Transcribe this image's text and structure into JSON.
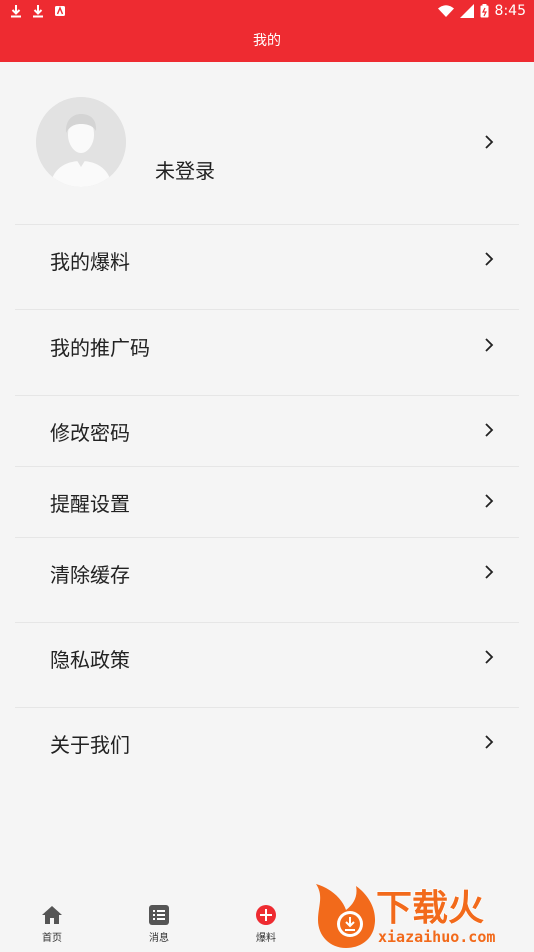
{
  "status_bar": {
    "time": "8:45"
  },
  "header": {
    "title": "我的"
  },
  "profile": {
    "login_status": "未登录"
  },
  "menu": {
    "items": [
      {
        "label": "我的爆料"
      },
      {
        "label": "我的推广码"
      },
      {
        "label": "修改密码"
      },
      {
        "label": "提醒设置"
      },
      {
        "label": "清除缓存"
      },
      {
        "label": "隐私政策"
      },
      {
        "label": "关于我们"
      }
    ]
  },
  "bottom_nav": {
    "items": [
      {
        "label": "首页",
        "icon": "home-icon"
      },
      {
        "label": "消息",
        "icon": "list-icon"
      },
      {
        "label": "爆料",
        "icon": "plus-circle-icon"
      }
    ]
  },
  "watermark": {
    "title": "下载火",
    "url": "xiazaihuo.com"
  },
  "colors": {
    "accent": "#ee2b31",
    "background": "#f5f5f5",
    "divider": "#e6e6e6"
  }
}
